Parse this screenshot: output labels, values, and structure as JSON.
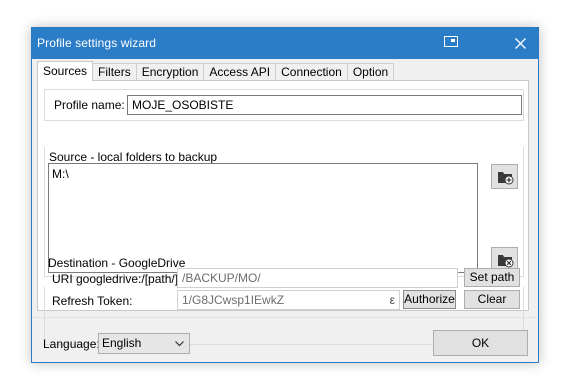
{
  "window": {
    "title": "Profile settings wizard"
  },
  "tabs": [
    {
      "label": "Sources",
      "active": true
    },
    {
      "label": "Filters"
    },
    {
      "label": "Encryption"
    },
    {
      "label": "Access API"
    },
    {
      "label": "Connection"
    },
    {
      "label": "Option"
    }
  ],
  "profile": {
    "label": "Profile name:",
    "value": "MOJE_OSOBISTE"
  },
  "source": {
    "legend": "Source - local folders to backup",
    "folders": [
      "M:\\"
    ],
    "add_icon": "folder-add-icon",
    "remove_icon": "folder-remove-icon"
  },
  "destination": {
    "legend": "Destination - GoogleDrive",
    "uri_label": "URI googledrive:/[path/]",
    "uri_value": "/BACKUP/MO/",
    "set_path_label": "Set path",
    "token_label": "Refresh Token:",
    "token_value": "1/G8JCwsp1IEwkZ",
    "token_overflow": "ε",
    "authorize_label": "Authorize",
    "clear_label": "Clear"
  },
  "footer": {
    "language_label": "Language:",
    "language_value": "English",
    "ok_label": "OK"
  },
  "colors": {
    "titlebar": "#2b7dc8",
    "window_bg": "#f0f0f0",
    "button_bg": "#e1e1e1"
  }
}
